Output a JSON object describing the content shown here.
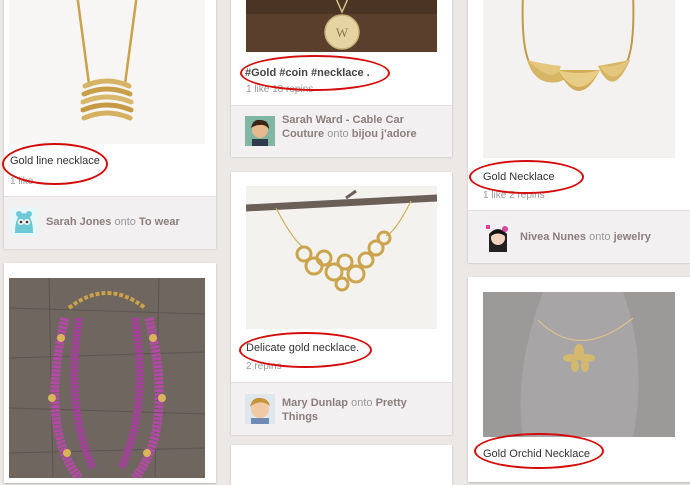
{
  "pins": [
    {
      "id": "gold-line",
      "description": "Gold line necklace",
      "stats": "1 like",
      "pinner": "Sarah Jones",
      "onto": "onto",
      "board": "To wear"
    },
    {
      "id": "coin",
      "description": "#Gold #coin #necklace .",
      "stats": "1 like   18 repins",
      "pinner": "Sarah Ward - Cable Car Couture",
      "onto": "onto",
      "board": "bijou j'adore"
    },
    {
      "id": "delicate",
      "description": "Delicate gold necklace.",
      "stats": "2 repins",
      "pinner": "Mary Dunlap",
      "onto": "onto",
      "board": "Pretty Things"
    },
    {
      "id": "gold-necklace",
      "description": "Gold Necklace",
      "stats": "1 like   2 repins",
      "pinner": "Nivea Nunes",
      "onto": "onto",
      "board": "jewelry"
    },
    {
      "id": "orchid",
      "description": "Gold Orchid Necklace"
    }
  ],
  "coin_letter": "W",
  "colors": {
    "annotation_ring": "#d40b0b",
    "link": "#8c7e7e",
    "background": "#ebe8e6"
  }
}
